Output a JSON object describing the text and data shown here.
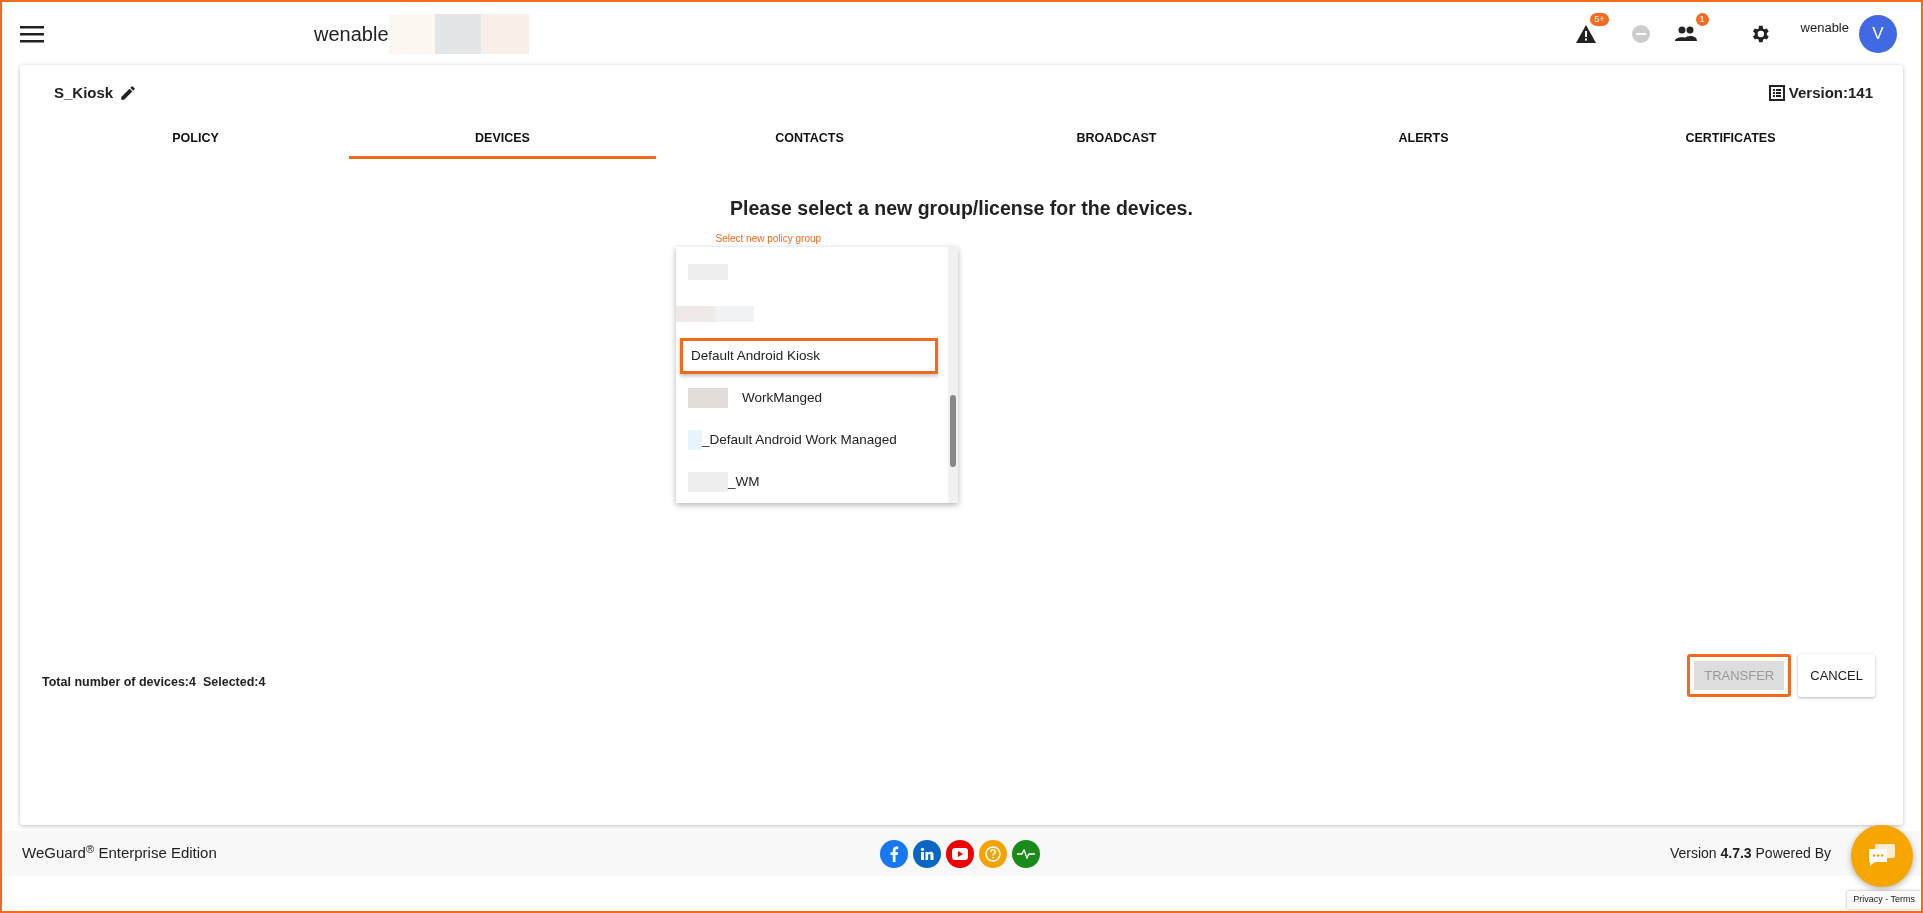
{
  "header": {
    "brand": "wenable",
    "alerts_badge": "5+",
    "users_badge": "1",
    "user_name": "wenable",
    "avatar_letter": "V"
  },
  "policy": {
    "name": "S_Kiosk",
    "version": "Version:141"
  },
  "tabs": [
    {
      "label": "POLICY",
      "selected": false
    },
    {
      "label": "DEVICES",
      "selected": true
    },
    {
      "label": "CONTACTS",
      "selected": false
    },
    {
      "label": "BROADCAST",
      "selected": false
    },
    {
      "label": "ALERTS",
      "selected": false
    },
    {
      "label": "CERTIFICATES",
      "selected": false
    }
  ],
  "transfer": {
    "heading": "Please select a new group/license for the devices.",
    "field_label": "Select new policy group",
    "options": [
      {
        "kind": "masked",
        "highlighted": false
      },
      {
        "kind": "masked",
        "highlighted": false
      },
      {
        "kind": "text",
        "label": "Default Android Kiosk",
        "highlighted": true
      },
      {
        "kind": "masked",
        "label": "WorkManged",
        "highlighted": false
      },
      {
        "kind": "masked",
        "label": "_Default Android Work Managed",
        "highlighted": false
      },
      {
        "kind": "masked",
        "label": "_WM",
        "highlighted": false
      }
    ],
    "summary": "Total number of devices:4  Selected:4",
    "buttons": [
      {
        "label": "TRANSFER",
        "disabled": true,
        "highlighted": true
      },
      {
        "label": "CANCEL",
        "disabled": false,
        "highlighted": false
      }
    ]
  },
  "footer": {
    "edition": "WeGuard$^{®}$ Enterprise Edition",
    "version_prefix": "Version ",
    "version": "4.7.3",
    "powered": "Powered By",
    "recaptcha": "Privacy - Terms"
  }
}
